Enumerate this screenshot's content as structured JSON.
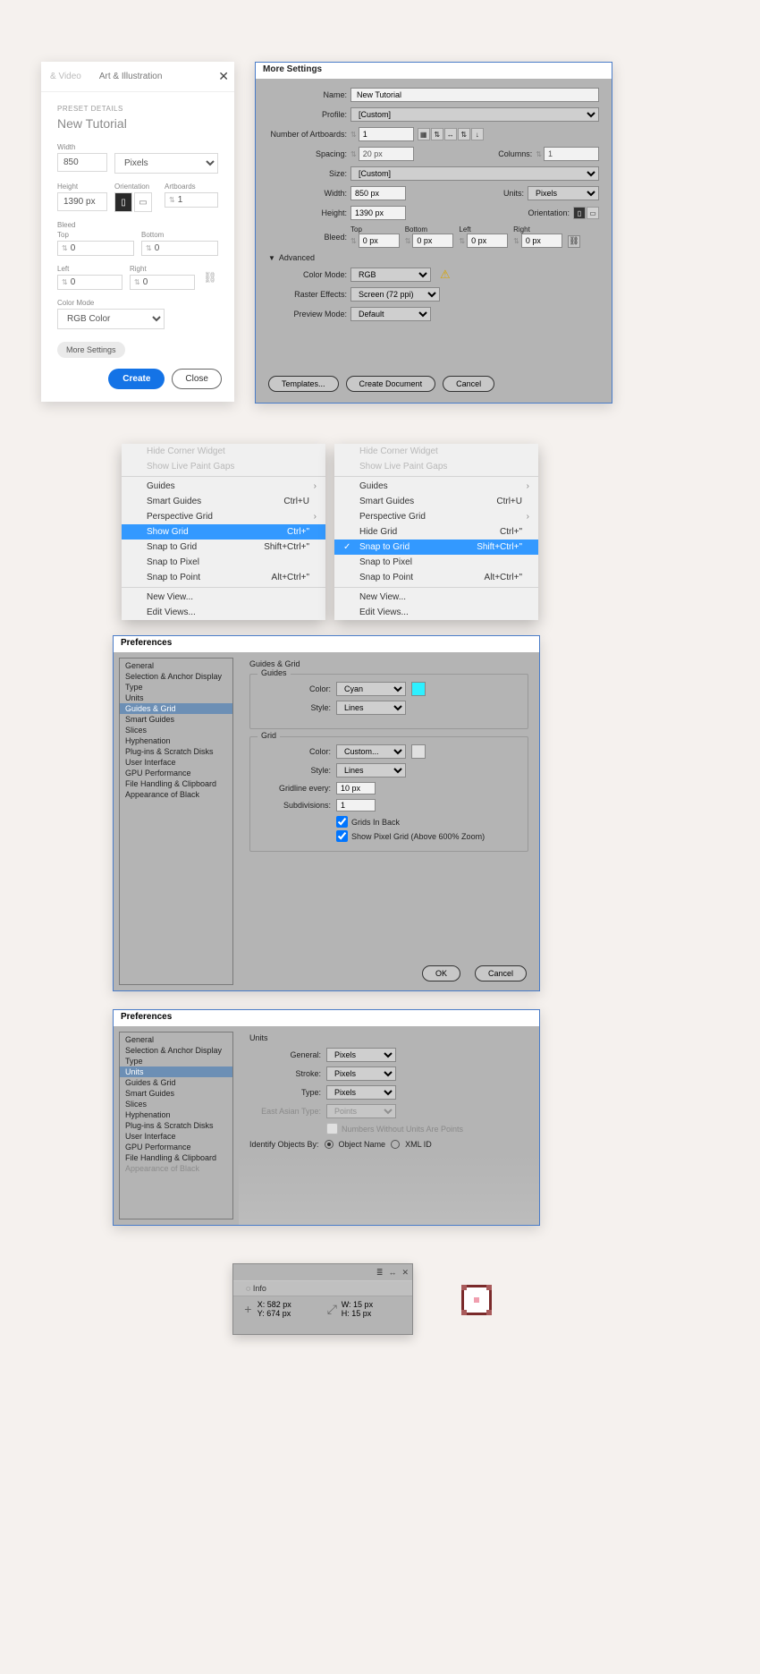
{
  "panel1": {
    "tabs": {
      "t1": "& Video",
      "t2": "Art & Illustration"
    },
    "close": "✕",
    "preset_heading": "PRESET DETAILS",
    "name": "New Tutorial",
    "width_label": "Width",
    "width_value": "850",
    "units": "Pixels",
    "height_label": "Height",
    "height_value": "1390 px",
    "orientation_label": "Orientation",
    "artboards_label": "Artboards",
    "artboards_value": "1",
    "bleed_label": "Bleed",
    "top_label": "Top",
    "top_value": "0",
    "bottom_label": "Bottom",
    "bottom_value": "0",
    "left_label": "Left",
    "left_value": "0",
    "right_label": "Right",
    "right_value": "0",
    "colormode_label": "Color Mode",
    "colormode_value": "RGB Color",
    "more": "More Settings",
    "create": "Create",
    "close_btn": "Close"
  },
  "panel2": {
    "title": "More Settings",
    "name_label": "Name:",
    "name": "New Tutorial",
    "profile_label": "Profile:",
    "profile": "[Custom]",
    "artboards_label": "Number of Artboards:",
    "artboards": "1",
    "spacing_label": "Spacing:",
    "spacing": "20 px",
    "columns_label": "Columns:",
    "columns": "1",
    "size_label": "Size:",
    "size": "[Custom]",
    "width_label": "Width:",
    "width": "850 px",
    "units_label": "Units:",
    "units": "Pixels",
    "height_label": "Height:",
    "height": "1390 px",
    "orientation_label": "Orientation:",
    "bleed_label": "Bleed:",
    "top_label": "Top",
    "top": "0 px",
    "bottom_label": "Bottom",
    "bottom": "0 px",
    "left_label": "Left",
    "left": "0 px",
    "right_label": "Right",
    "right": "0 px",
    "advanced": "Advanced",
    "colormode_label": "Color Mode:",
    "colormode": "RGB",
    "raster_label": "Raster Effects:",
    "raster": "Screen (72 ppi)",
    "preview_label": "Preview Mode:",
    "preview": "Default",
    "templates": "Templates...",
    "create_doc": "Create Document",
    "cancel": "Cancel"
  },
  "menusA": {
    "dim1": "Hide Corner Widget",
    "dim2": "Show Live Paint Gaps",
    "guides": "Guides",
    "smart": "Smart Guides",
    "smart_key": "Ctrl+U",
    "persp": "Perspective Grid",
    "showgrid": "Show Grid",
    "showgrid_key": "Ctrl+\"",
    "snapgrid": "Snap to Grid",
    "snapgrid_key": "Shift+Ctrl+\"",
    "snapx": "Snap to Pixel",
    "snappt": "Snap to Point",
    "snappt_key": "Alt+Ctrl+\"",
    "nv": "New View...",
    "ev": "Edit Views..."
  },
  "menusB": {
    "dim1": "Hide Corner Widget",
    "dim2": "Show Live Paint Gaps",
    "guides": "Guides",
    "smart": "Smart Guides",
    "smart_key": "Ctrl+U",
    "persp": "Perspective Grid",
    "hidegrid": "Hide Grid",
    "hidegrid_key": "Ctrl+\"",
    "snapgrid": "Snap to Grid",
    "snapgrid_key": "Shift+Ctrl+\"",
    "snapx": "Snap to Pixel",
    "snappt": "Snap to Point",
    "snappt_key": "Alt+Ctrl+\"",
    "nv": "New View...",
    "ev": "Edit Views..."
  },
  "prefs_side": {
    "s0": "General",
    "s1": "Selection & Anchor Display",
    "s2": "Type",
    "s3": "Units",
    "s4": "Guides & Grid",
    "s5": "Smart Guides",
    "s6": "Slices",
    "s7": "Hyphenation",
    "s8": "Plug-ins & Scratch Disks",
    "s9": "User Interface",
    "s10": "GPU Performance",
    "s11": "File Handling & Clipboard",
    "s12": "Appearance of Black"
  },
  "prefs1": {
    "title": "Preferences",
    "heading": "Guides & Grid",
    "guides_legend": "Guides",
    "color_label": "Color:",
    "guides_color": "Cyan",
    "guides_swatch": "#2ef0ff",
    "style_label": "Style:",
    "guides_style": "Lines",
    "grid_legend": "Grid",
    "grid_color": "Custom...",
    "grid_swatch": "#e0e0e0",
    "grid_style": "Lines",
    "every_label": "Gridline every:",
    "every": "10 px",
    "sub_label": "Subdivisions:",
    "sub": "1",
    "check1": "Grids In Back",
    "check2": "Show Pixel Grid (Above 600% Zoom)",
    "ok": "OK",
    "cancel": "Cancel"
  },
  "prefs2": {
    "title": "Preferences",
    "heading": "Units",
    "general_label": "General:",
    "general": "Pixels",
    "stroke_label": "Stroke:",
    "stroke": "Pixels",
    "type_label": "Type:",
    "type": "Pixels",
    "ea_label": "East Asian Type:",
    "ea": "Points",
    "ea_check": "Numbers Without Units Are Points",
    "identify_label": "Identify Objects By:",
    "r1": "Object Name",
    "r2": "XML ID"
  },
  "info": {
    "tab1": "≣",
    "tab2": "↔",
    "tab3": "✕",
    "tab": "Info",
    "x_label": "X:",
    "x": "582 px",
    "y_label": "Y:",
    "y": "674 px",
    "w_label": "W:",
    "w": "15 px",
    "h_label": "H:",
    "h": "15 px"
  }
}
